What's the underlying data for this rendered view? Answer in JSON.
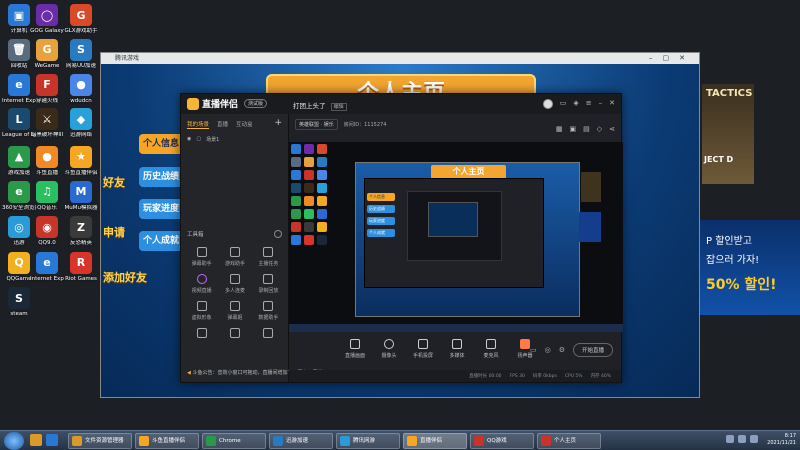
{
  "desktop_icons": [
    {
      "label": "计算机",
      "color": "#2a78d6",
      "glyph": "▣"
    },
    {
      "label": "GOG Galaxy",
      "color": "#6b2ca8",
      "glyph": "◯"
    },
    {
      "label": "GLX游戏助手",
      "color": "#d84a2a",
      "glyph": "G"
    },
    {
      "label": "回收站",
      "color": "#5a6b7d",
      "glyph": "🗑"
    },
    {
      "label": "WeGame",
      "color": "#e6a23c",
      "glyph": "G"
    },
    {
      "label": "网易UU加速",
      "color": "#2a7ac0",
      "glyph": "S"
    },
    {
      "label": "Internet Explorer",
      "color": "#2a78d6",
      "glyph": "e"
    },
    {
      "label": "穿越火线",
      "color": "#c7342a",
      "glyph": "F"
    },
    {
      "label": "wdudcn",
      "color": "#4a86e8",
      "glyph": "●"
    },
    {
      "label": "League of Legends",
      "color": "#1c4a6e",
      "glyph": "L"
    },
    {
      "label": "暗黑破坏神III",
      "color": "#3a2a1a",
      "glyph": "⚔"
    },
    {
      "label": "迅游网络",
      "color": "#2aa0d8",
      "glyph": "◆"
    },
    {
      "label": "游戏加速",
      "color": "#2a9a4a",
      "glyph": "▲"
    },
    {
      "label": "斗鱼直播",
      "color": "#f08a24",
      "glyph": "●"
    },
    {
      "label": "斗鱼直播伴侣",
      "color": "#f5a623",
      "glyph": "★"
    },
    {
      "label": "360安全浏览器",
      "color": "#2a9a4a",
      "glyph": "e"
    },
    {
      "label": "QQ音乐",
      "color": "#2abf60",
      "glyph": "♫"
    },
    {
      "label": "MuMu模拟器",
      "color": "#2a6ad0",
      "glyph": "M"
    },
    {
      "label": "迅游",
      "color": "#2a9ad8",
      "glyph": "◎"
    },
    {
      "label": "QQ9.0",
      "color": "#c7342a",
      "glyph": "◉"
    },
    {
      "label": "反恐精英",
      "color": "#3a3a3a",
      "glyph": "Z"
    },
    {
      "label": "QQGame",
      "color": "#f0b020",
      "glyph": "Q"
    },
    {
      "label": "Internet Explorer",
      "color": "#2a78d6",
      "glyph": "e"
    },
    {
      "label": "Riot Games",
      "color": "#d8342a",
      "glyph": "R"
    },
    {
      "label": "steam",
      "color": "#1b2838",
      "glyph": "S"
    }
  ],
  "game_window": {
    "title": "腾讯游戏",
    "banner": "个人主页",
    "menu": [
      "个人信息",
      "历史战绩",
      "玩家进度",
      "个人成就"
    ],
    "side": [
      "好友",
      "申请",
      "添加好友"
    ]
  },
  "ads": {
    "ad1_title": "TACTICS",
    "ad1_sub": "JECT D",
    "ad2_line1": "",
    "ad2_line2": "P 할인받고",
    "ad2_line3": "잡으러 가자!",
    "ad2_line4": "50% 할인!"
  },
  "app": {
    "brand": "直播伴侣",
    "version": "测试版",
    "stream_title": "打团上头了",
    "edit_label": "编辑",
    "tabs": [
      "我的场景",
      "直播",
      "互动盒"
    ],
    "scene_label": "场景1",
    "category_pill": "英雄联盟 · 娱乐",
    "room_id": "房间ID：1115274",
    "tools_title": "工具箱",
    "tools": [
      "弹幕助手",
      "游戏助手",
      "主播任务",
      "视频直播",
      "多人连麦",
      "录制回放",
      "虚拟形象",
      "弹幕姬",
      "数据助手",
      "",
      "",
      ""
    ],
    "notice": "斗鱼公告：音效小窗口可拖动，直播间增加了，更上一层楼",
    "bottom_buttons": [
      "直播画面",
      "摄像头",
      "手机投屏",
      "多媒体",
      "麦克风",
      "扬声器"
    ],
    "start_live": "开始直播",
    "status_items": [
      "直播时长 00:00",
      "FPS 30",
      "码率 0kbps",
      "CPU 5%",
      "内存 40%"
    ]
  },
  "taskbar": {
    "tasks": [
      {
        "label": "文件资源管理器",
        "color": "#d89a2a"
      },
      {
        "label": "斗鱼直播伴侣",
        "color": "#f5a623"
      },
      {
        "label": "Chrome",
        "color": "#2a9a4a"
      },
      {
        "label": "迅游加速",
        "color": "#2a7ac0"
      },
      {
        "label": "腾讯网游",
        "color": "#2a9ad8"
      },
      {
        "label": "直播伴侣",
        "color": "#f5a623"
      },
      {
        "label": "QQ游戏",
        "color": "#c7342a"
      },
      {
        "label": "个人主页",
        "color": "#c7342a"
      }
    ],
    "time": "8:17",
    "date": "2021/11/21"
  }
}
